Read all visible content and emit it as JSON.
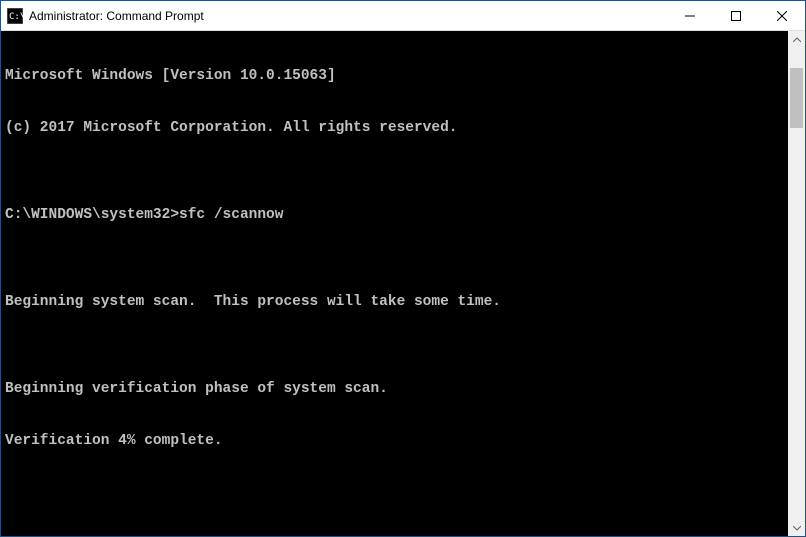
{
  "window": {
    "title": "Administrator: Command Prompt"
  },
  "terminal": {
    "lines": [
      "Microsoft Windows [Version 10.0.15063]",
      "(c) 2017 Microsoft Corporation. All rights reserved.",
      "",
      "C:\\WINDOWS\\system32>sfc /scannow",
      "",
      "Beginning system scan.  This process will take some time.",
      "",
      "Beginning verification phase of system scan.",
      "Verification 4% complete."
    ]
  }
}
